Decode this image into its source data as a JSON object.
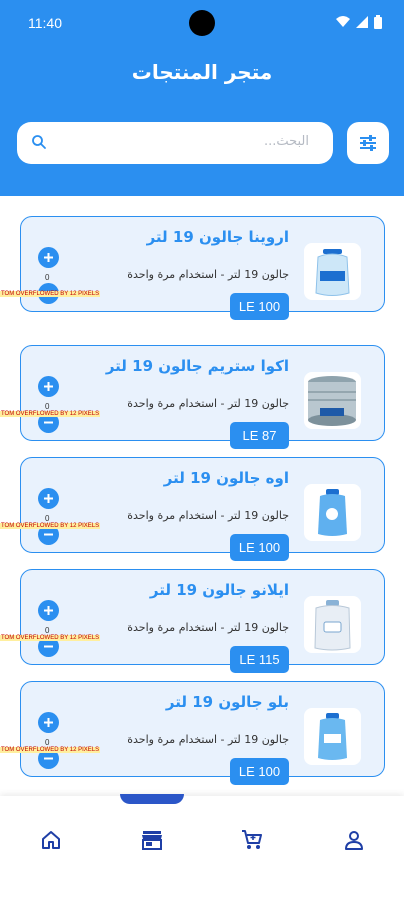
{
  "status_bar": {
    "time": "11:40"
  },
  "header": {
    "title": "متجر المنتجات"
  },
  "search": {
    "placeholder": "البحث..."
  },
  "products": [
    {
      "title": "اروينا جالون 19 لتر",
      "description": "جالون 19 لتر - استخدام مرة واحدة",
      "price": "LE 100",
      "quantity": "0",
      "overflow_text": "TOM OVERFLOWED BY 12 PIXELS"
    },
    {
      "title": "اكوا ستريم جالون 19 لتر",
      "description": "جالون 19 لتر - استخدام مرة واحدة",
      "price": "LE 87",
      "quantity": "0",
      "overflow_text": "TOM OVERFLOWED BY 12 PIXELS"
    },
    {
      "title": "اوه جالون 19 لتر",
      "description": "جالون 19 لتر - استخدام مرة واحدة",
      "price": "LE 100",
      "quantity": "0",
      "overflow_text": "TOM OVERFLOWED BY 12 PIXELS"
    },
    {
      "title": "ايلانو جالون 19 لتر",
      "description": "جالون 19 لتر - استخدام مرة واحدة",
      "price": "LE 115",
      "quantity": "0",
      "overflow_text": "TOM OVERFLOWED BY 12 PIXELS"
    },
    {
      "title": "بلو جالون 19 لتر",
      "description": "جالون 19 لتر - استخدام مرة واحدة",
      "price": "LE 100",
      "quantity": "0",
      "overflow_text": "TOM OVERFLOWED BY 12 PIXELS"
    }
  ],
  "bottom_nav": {
    "items": [
      {
        "icon": "home-icon"
      },
      {
        "icon": "store-icon",
        "active": true
      },
      {
        "icon": "cart-icon"
      },
      {
        "icon": "person-icon"
      }
    ]
  },
  "colors": {
    "primary": "#2b8ff0",
    "card_bg": "#e9f2fd",
    "nav_icon": "#1f3fa6"
  }
}
